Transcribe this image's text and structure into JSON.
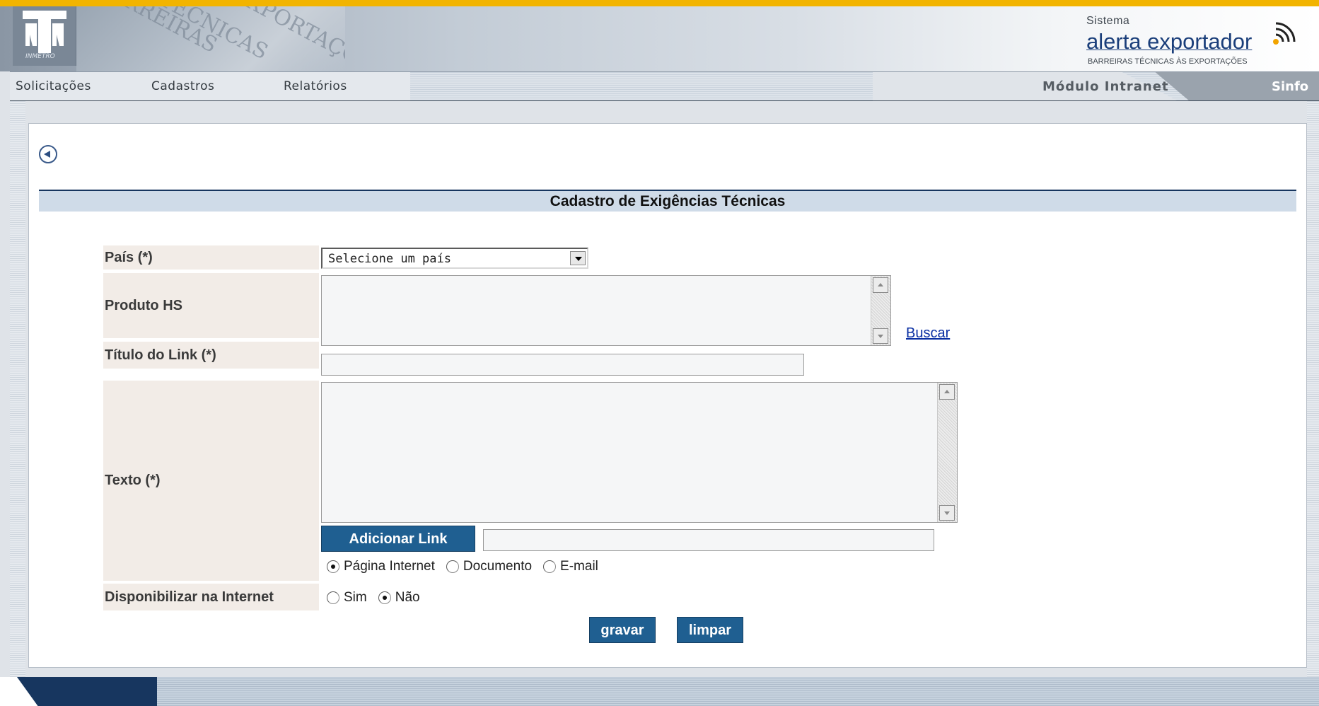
{
  "header": {
    "logo_text": "INMETRO",
    "deco_words": [
      "BARREIRAS",
      "TÉCNICAS",
      "EXPORTAÇÕES"
    ],
    "brand_top": "Sistema",
    "brand_main": "alerta exportador",
    "brand_sub": "BARREIRAS TÉCNICAS ÀS EXPORTAÇÕES"
  },
  "nav": {
    "items": [
      "Solicitações",
      "Cadastros",
      "Relatórios"
    ],
    "module": "Módulo Intranet",
    "sinfo": "Sinfo"
  },
  "page": {
    "title": "Cadastro de Exigências Técnicas"
  },
  "form": {
    "pais_label": "País (*)",
    "pais_selected": "Selecione um país",
    "produto_label": "Produto HS",
    "produto_value": "",
    "buscar_link": "Buscar",
    "titulo_label": "Título do Link (*)",
    "titulo_value": "",
    "texto_label": "Texto (*)",
    "texto_value": "",
    "add_link_button": "Adicionar Link",
    "link_value": "",
    "link_types": [
      {
        "label": "Página Internet",
        "checked": true
      },
      {
        "label": "Documento",
        "checked": false
      },
      {
        "label": "E-mail",
        "checked": false
      }
    ],
    "internet_label": "Disponibilizar na Internet",
    "internet_options": [
      {
        "label": "Sim",
        "checked": false
      },
      {
        "label": "Não",
        "checked": true
      }
    ],
    "save_button": "gravar",
    "clear_button": "limpar"
  },
  "colors": {
    "accent_top": "#f2b400",
    "button_bg": "#1f5f91",
    "title_border": "#17365f",
    "label_bg": "#f2ece7"
  }
}
